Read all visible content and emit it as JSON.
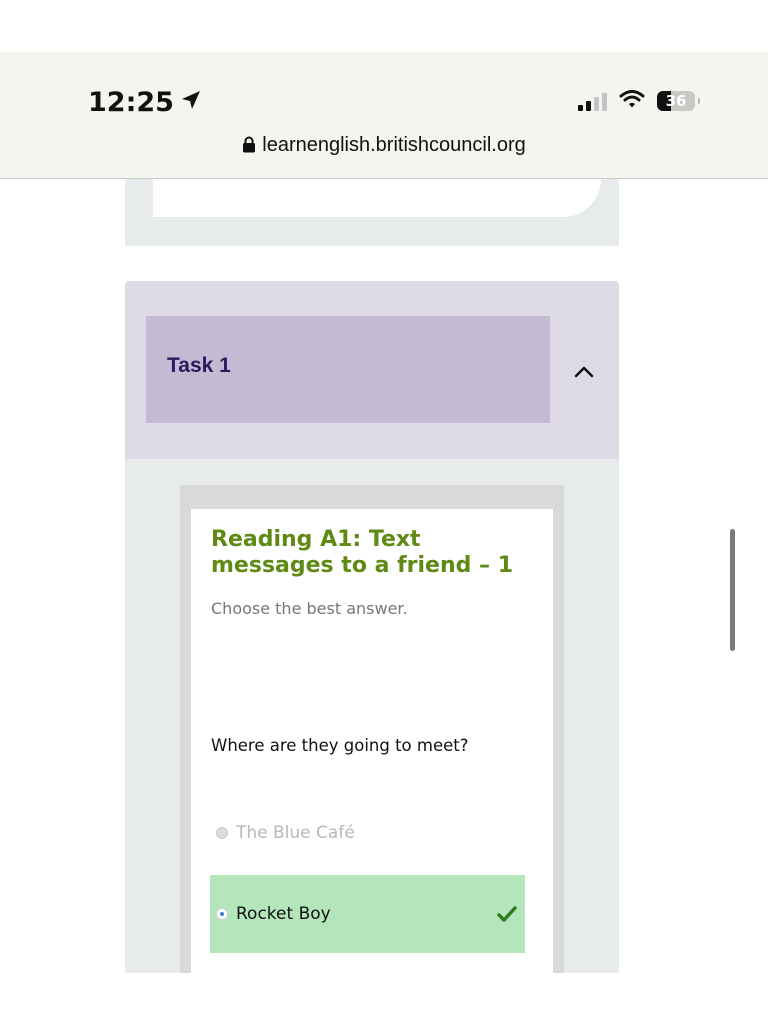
{
  "status_bar": {
    "time": "12:25",
    "battery_level": "36",
    "battery_fraction": 0.36
  },
  "browser": {
    "url": "learnenglish.britishcouncil.org"
  },
  "task": {
    "title": "Task 1"
  },
  "quiz": {
    "title": "Reading A1: Text messages to a friend – 1",
    "instruction": "Choose the best answer.",
    "question": "Where are they going to meet?",
    "options": [
      {
        "label": "The Blue Café",
        "selected": false
      },
      {
        "label": "Rocket Boy",
        "selected": true,
        "correct": true
      }
    ]
  },
  "icons": {
    "location": "location-arrow-icon",
    "lock": "lock-icon",
    "collapse": "chevron-up-icon",
    "check": "check-icon"
  },
  "colors": {
    "quiz_title": "#5f8a14",
    "task_title": "#2a1a5e",
    "task_header_bg": "#c3bbd3",
    "task_section_bg": "#dedbe6",
    "correct_answer_bg": "#b5e6bb",
    "check": "#2e7d1e"
  }
}
